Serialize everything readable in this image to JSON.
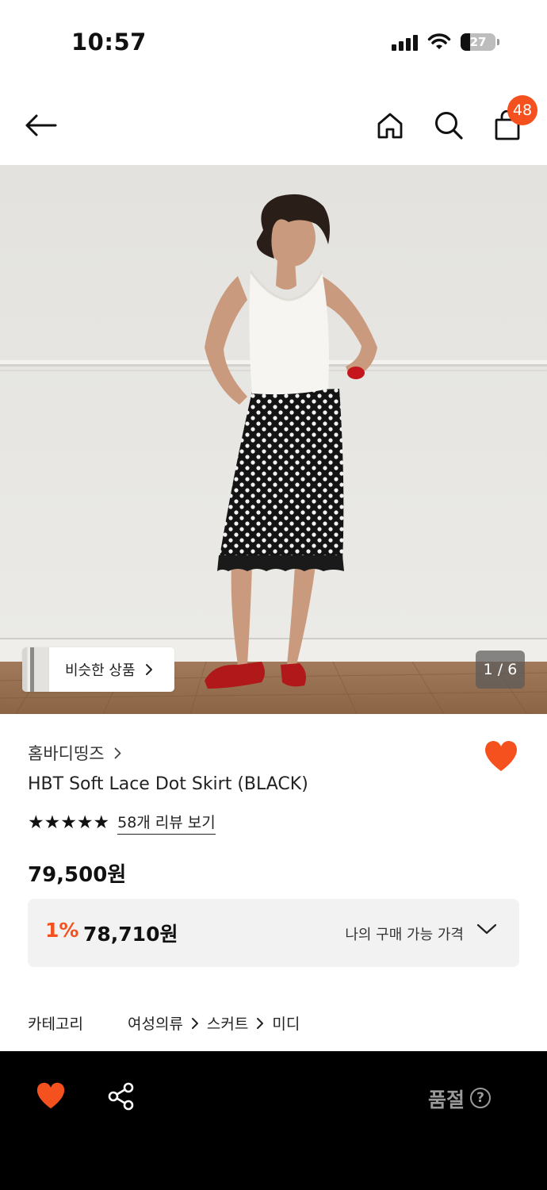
{
  "status_bar": {
    "time": "10:57",
    "battery": "27",
    "battery_level": 0.27
  },
  "nav": {
    "cart_count": "48"
  },
  "gallery": {
    "similar_label": "비슷한 상품",
    "page_counter": "1 / 6"
  },
  "product": {
    "brand": "홈바디띵즈",
    "name": "HBT Soft Lace Dot Skirt (BLACK)",
    "stars": "★★★★★",
    "rating": 5,
    "review_link": "58개 리뷰 보기",
    "price": "79,500원",
    "my_price": {
      "discount": "1%",
      "value": "78,710원",
      "label": "나의 구매 가능 가격"
    },
    "category": {
      "label": "카테고리",
      "path": [
        "여성의류",
        "스커트",
        "미디"
      ]
    }
  },
  "bottom_bar": {
    "status": "품절",
    "help": "?"
  },
  "colors": {
    "accent": "#f5511e",
    "bottom_bar": "#000000",
    "status_gray": "#9a9a9a"
  },
  "icons": [
    "back-arrow-icon",
    "home-icon",
    "search-icon",
    "shopping-bag-icon",
    "heart-icon",
    "share-icon",
    "chevron-right-icon",
    "chevron-down-icon",
    "help-icon"
  ]
}
